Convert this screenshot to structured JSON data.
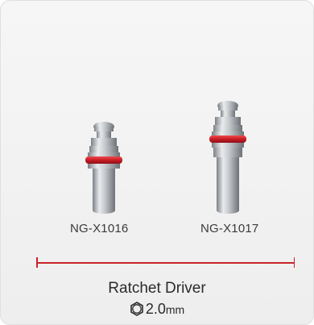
{
  "products": [
    {
      "code": "NG-X1016"
    },
    {
      "code": "NG-X1017"
    }
  ],
  "tool": {
    "name": "Ratchet Driver",
    "size_value": "2.0",
    "size_unit": "mm",
    "size_icon": "hexagon-icon"
  },
  "colors": {
    "accent": "#c9242b",
    "oring": "#d0202a",
    "metal": "#b8bcc0",
    "background": "#f2f2f2"
  }
}
